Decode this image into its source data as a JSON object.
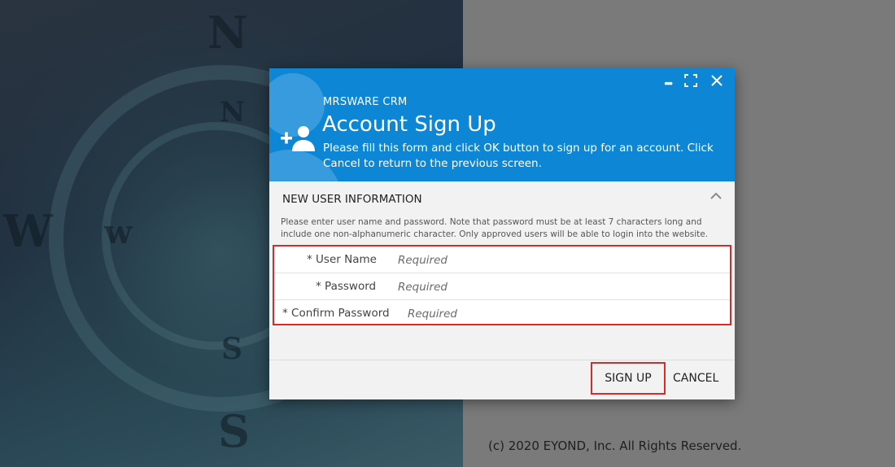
{
  "background": {
    "compass_letters": [
      "N",
      "N",
      "W",
      "w",
      "S",
      "S"
    ]
  },
  "footer_page": {
    "copyright": "(c) 2020 EYOND, Inc. All Rights Reserved."
  },
  "dialog": {
    "app_name": "MRSWARE CRM",
    "title": "Account Sign Up",
    "subtitle": "Please fill this form and click OK button to sign up for an account. Click Cancel to return to the previous screen.",
    "header_icons": {
      "more": "•••",
      "maximize": "⛶",
      "close": "✕"
    },
    "section": {
      "title": "NEW USER INFORMATION",
      "note": "Please enter user name and password. Note that password must be at least 7 characters long and include one non-alphanumeric character. Only approved users will be able to login into the website."
    },
    "fields": [
      {
        "label": "* User Name",
        "placeholder": "Required"
      },
      {
        "label": "* Password",
        "placeholder": "Required"
      },
      {
        "label": "* Confirm Password",
        "placeholder": "Required"
      }
    ],
    "buttons": {
      "sign_up": "SIGN UP",
      "cancel": "CANCEL"
    }
  },
  "colors": {
    "header": "#0d86d6",
    "highlight": "#d42b2b"
  }
}
